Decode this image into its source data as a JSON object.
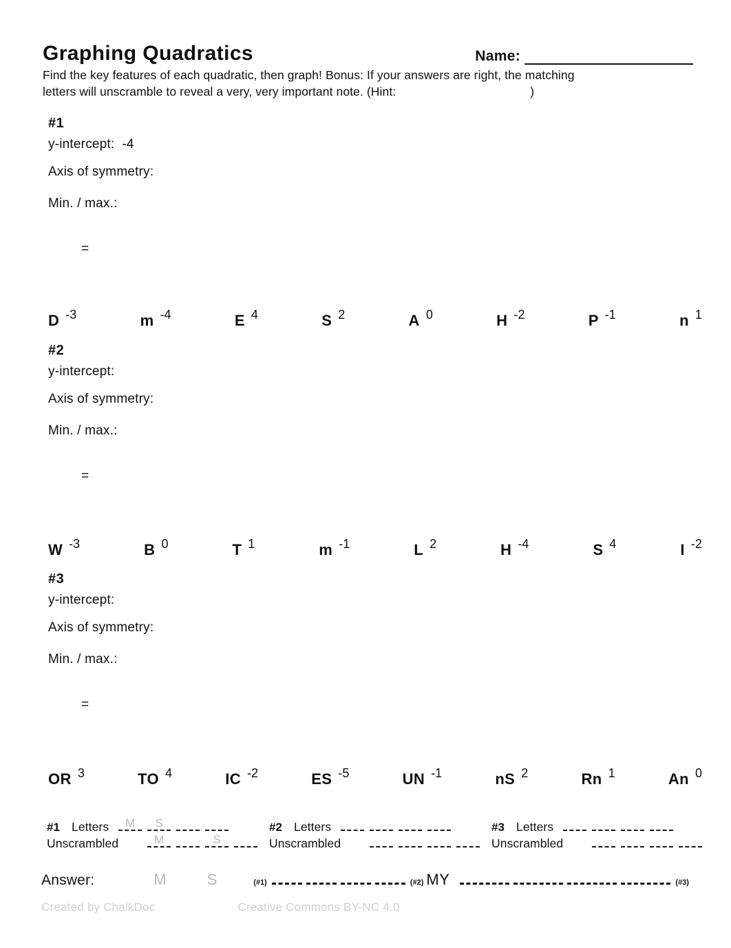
{
  "document": {
    "title": "Graphing Quadratics",
    "name_label": "Name:",
    "instructions_line1": "Find the key features of each quadratic, then graph!  Bonus:  If your answers are right, the matching",
    "instructions_line2_a": "letters will unscramble to reveal a very, very important note.  (Hint:",
    "instructions_line2_b": ")"
  },
  "problems": [
    {
      "number": "#1",
      "y_intercept_label": "y-intercept:",
      "y_intercept_value": "-4",
      "axis_label": "Axis of symmetry:",
      "minmax_label": "Min. / max.:",
      "equals": "=",
      "letters": [
        {
          "letter": "D",
          "value": "-3"
        },
        {
          "letter": "m",
          "value": "-4"
        },
        {
          "letter": "E",
          "value": "4"
        },
        {
          "letter": "S",
          "value": "2"
        },
        {
          "letter": "A",
          "value": "0"
        },
        {
          "letter": "H",
          "value": "-2"
        },
        {
          "letter": "P",
          "value": "-1"
        },
        {
          "letter": "n",
          "value": "1"
        }
      ]
    },
    {
      "number": "#2",
      "y_intercept_label": "y-intercept:",
      "y_intercept_value": "",
      "axis_label": "Axis of symmetry:",
      "minmax_label": "Min. / max.:",
      "equals": "=",
      "letters": [
        {
          "letter": "W",
          "value": "-3"
        },
        {
          "letter": "B",
          "value": "0"
        },
        {
          "letter": "T",
          "value": "1"
        },
        {
          "letter": "m",
          "value": "-1"
        },
        {
          "letter": "L",
          "value": "2"
        },
        {
          "letter": "H",
          "value": "-4"
        },
        {
          "letter": "S",
          "value": "4"
        },
        {
          "letter": "I",
          "value": "-2"
        }
      ]
    },
    {
      "number": "#3",
      "y_intercept_label": "y-intercept:",
      "y_intercept_value": "",
      "axis_label": "Axis of symmetry:",
      "minmax_label": "Min. / max.:",
      "equals": "=",
      "letters": [
        {
          "letter": "OR",
          "value": "3"
        },
        {
          "letter": "TO",
          "value": "4"
        },
        {
          "letter": "IC",
          "value": "-2"
        },
        {
          "letter": "ES",
          "value": "-5"
        },
        {
          "letter": "UN",
          "value": "-1"
        },
        {
          "letter": "nS",
          "value": "2"
        },
        {
          "letter": "Rn",
          "value": "1"
        },
        {
          "letter": "An",
          "value": "0"
        }
      ]
    }
  ],
  "key_table": {
    "letters_label": "Letters",
    "unscrambled_label": "Unscrambled",
    "columns": [
      {
        "number": "#1",
        "letters_blanks": [
          "M",
          "S",
          "",
          ""
        ],
        "unscrambled_blanks": [
          "M",
          "",
          "S",
          ""
        ]
      },
      {
        "number": "#2",
        "letters_blanks": [
          "",
          "",
          "",
          ""
        ],
        "unscrambled_blanks": [
          "",
          "",
          "",
          ""
        ]
      },
      {
        "number": "#3",
        "letters_blanks": [
          "",
          "",
          "",
          ""
        ],
        "unscrambled_blanks": [
          "",
          "",
          "",
          ""
        ]
      }
    ]
  },
  "answer": {
    "label": "Answer:",
    "ghost_1": "M",
    "ghost_2": "S",
    "tag_1": "(#1)",
    "tag_2": "(#2)",
    "tag_3": "(#3)",
    "word_my": "MY"
  },
  "footer": {
    "created_by": "Created by ChalkDoc",
    "license": "Creative Commons BY-NC 4.0"
  }
}
